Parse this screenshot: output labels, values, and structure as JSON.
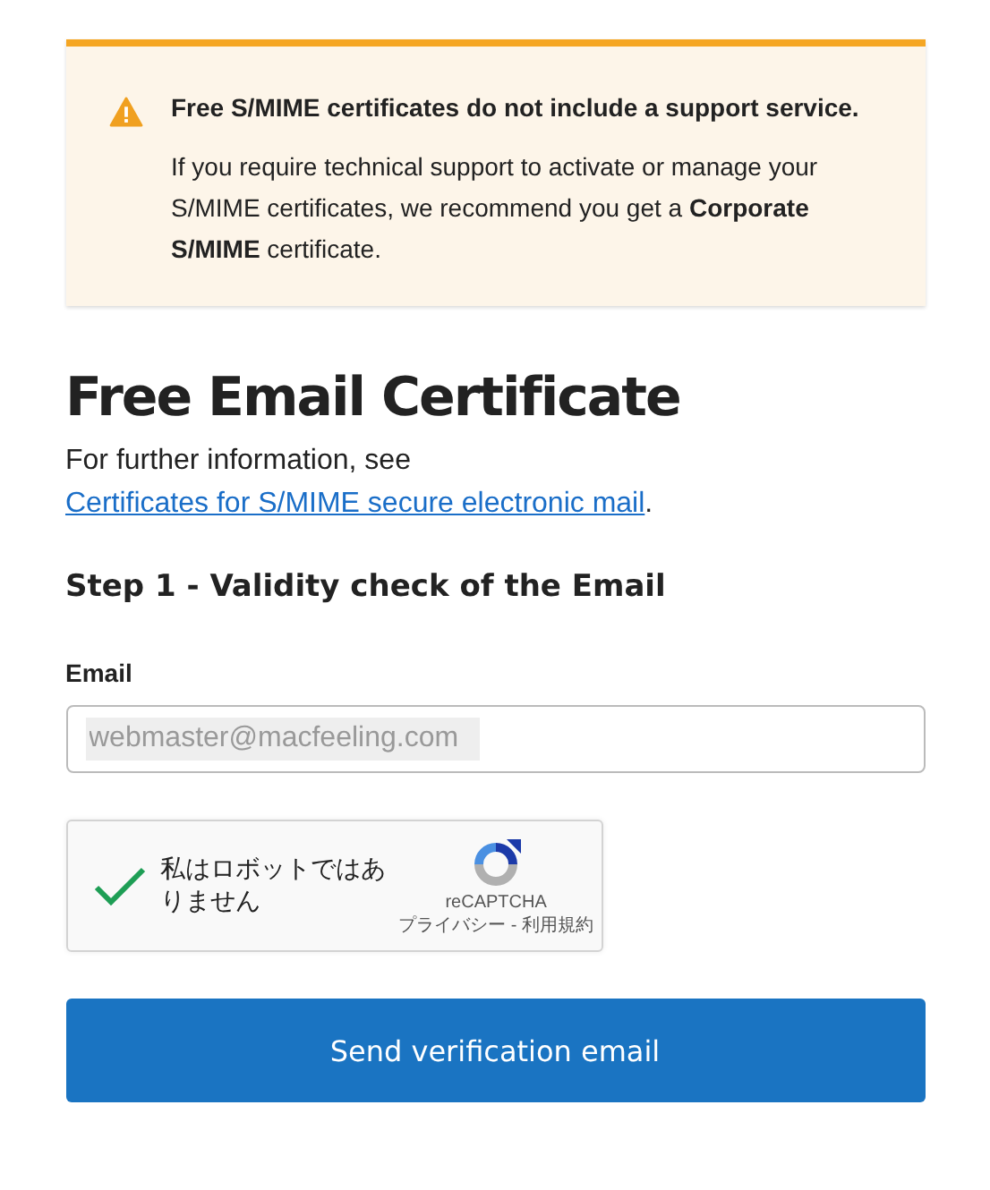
{
  "notice": {
    "title": "Free S/MIME certificates do not include a support service.",
    "body": "If you require technical support to activate or manage your S/MIME certificates, we recommend you get a **Corporate S/MIME** certificate."
  },
  "heading": "Free Email Certificate",
  "intro": {
    "text": "For further information, see",
    "link": "Certificates for S/MIME secure electronic mail",
    "end": "."
  },
  "step": "Step 1 - Validity check of the Email",
  "email": {
    "label": "Email",
    "value": "webmaster@macfeeling.com"
  },
  "captcha": {
    "checked": true,
    "label": "私はロボットではありません",
    "brand": "reCAPTCHA",
    "links": "プライバシー - 利用規約"
  },
  "submit": "Send verification email"
}
